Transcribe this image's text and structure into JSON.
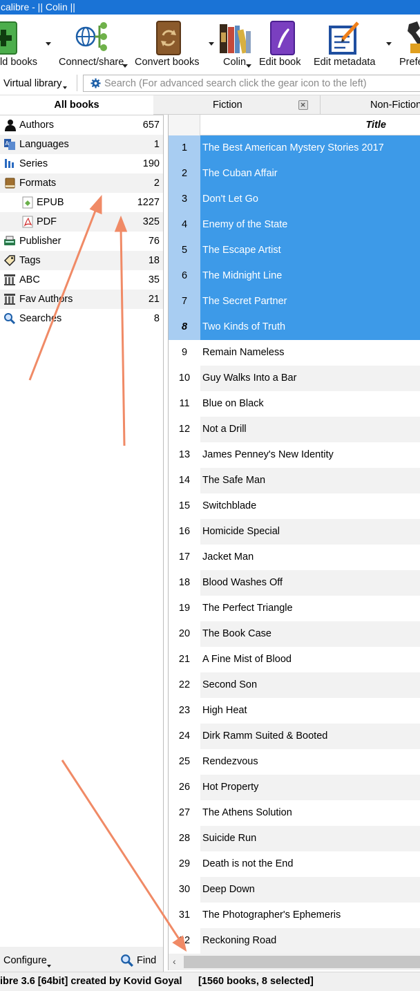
{
  "window": {
    "title": "calibre - || Colin ||"
  },
  "toolbar": {
    "add_books": "ld books",
    "connect_share": "Connect/share",
    "convert_books": "Convert books",
    "library": "Colin",
    "edit_book": "Edit book",
    "edit_metadata": "Edit metadata",
    "preferences": "Prefe"
  },
  "search": {
    "virtual_library": "Virtual library",
    "placeholder": "Search (For advanced search click the gear icon to the left)"
  },
  "tag_browser": {
    "tab": "All books",
    "items": [
      {
        "label": "Authors",
        "count": "657",
        "icon": "person-icon"
      },
      {
        "label": "Languages",
        "count": "1",
        "icon": "languages-icon"
      },
      {
        "label": "Series",
        "count": "190",
        "icon": "series-icon"
      },
      {
        "label": "Formats",
        "count": "2",
        "icon": "book-icon"
      },
      {
        "label": "EPUB",
        "count": "1227",
        "icon": "epub-icon"
      },
      {
        "label": "PDF",
        "count": "325",
        "icon": "pdf-icon"
      },
      {
        "label": "Publisher",
        "count": "76",
        "icon": "publisher-icon"
      },
      {
        "label": "Tags",
        "count": "18",
        "icon": "tag-icon"
      },
      {
        "label": "ABC",
        "count": "35",
        "icon": "column-icon"
      },
      {
        "label": "Fav Authors",
        "count": "21",
        "icon": "column-icon"
      },
      {
        "label": "Searches",
        "count": "8",
        "icon": "search-icon"
      }
    ],
    "configure": "Configure",
    "find": "Find"
  },
  "vl_tabs": {
    "fiction": "Fiction",
    "nonfiction": "Non-Fiction"
  },
  "book_list": {
    "header": "Title",
    "rows": [
      {
        "num": "1",
        "title": "The Best American Mystery Stories 2017"
      },
      {
        "num": "2",
        "title": "The Cuban Affair"
      },
      {
        "num": "3",
        "title": "Don't Let Go"
      },
      {
        "num": "4",
        "title": "Enemy of the State"
      },
      {
        "num": "5",
        "title": "The Escape Artist"
      },
      {
        "num": "6",
        "title": "The Midnight Line"
      },
      {
        "num": "7",
        "title": "The Secret Partner"
      },
      {
        "num": "8",
        "title": "Two Kinds of Truth"
      },
      {
        "num": "9",
        "title": "Remain Nameless"
      },
      {
        "num": "10",
        "title": "Guy Walks Into a Bar"
      },
      {
        "num": "11",
        "title": "Blue on Black"
      },
      {
        "num": "12",
        "title": "Not a Drill"
      },
      {
        "num": "13",
        "title": "James Penney's New Identity"
      },
      {
        "num": "14",
        "title": "The Safe Man"
      },
      {
        "num": "15",
        "title": "Switchblade"
      },
      {
        "num": "16",
        "title": "Homicide Special"
      },
      {
        "num": "17",
        "title": "Jacket Man"
      },
      {
        "num": "18",
        "title": "Blood Washes Off"
      },
      {
        "num": "19",
        "title": "The Perfect Triangle"
      },
      {
        "num": "20",
        "title": "The Book Case"
      },
      {
        "num": "21",
        "title": "A Fine Mist of Blood"
      },
      {
        "num": "22",
        "title": "Second Son"
      },
      {
        "num": "23",
        "title": "High Heat"
      },
      {
        "num": "24",
        "title": "Dirk Ramm Suited & Booted"
      },
      {
        "num": "25",
        "title": "Rendezvous"
      },
      {
        "num": "26",
        "title": "Hot Property"
      },
      {
        "num": "27",
        "title": "The Athens Solution"
      },
      {
        "num": "28",
        "title": "Suicide Run"
      },
      {
        "num": "29",
        "title": "Death is not the End"
      },
      {
        "num": "30",
        "title": "Deep Down"
      },
      {
        "num": "31",
        "title": "The Photographer's Ephemeris"
      },
      {
        "num": "32",
        "title": "Reckoning Road"
      }
    ],
    "selected_count": 8
  },
  "status": {
    "left": "ibre 3.6 [64bit] created by Kovid Goyal",
    "right": "[1560 books, 8 selected]"
  },
  "colors": {
    "titlebar": "#1a73d6",
    "selection": "#3d9ae8",
    "annotation_arrow": "#f08a66"
  }
}
